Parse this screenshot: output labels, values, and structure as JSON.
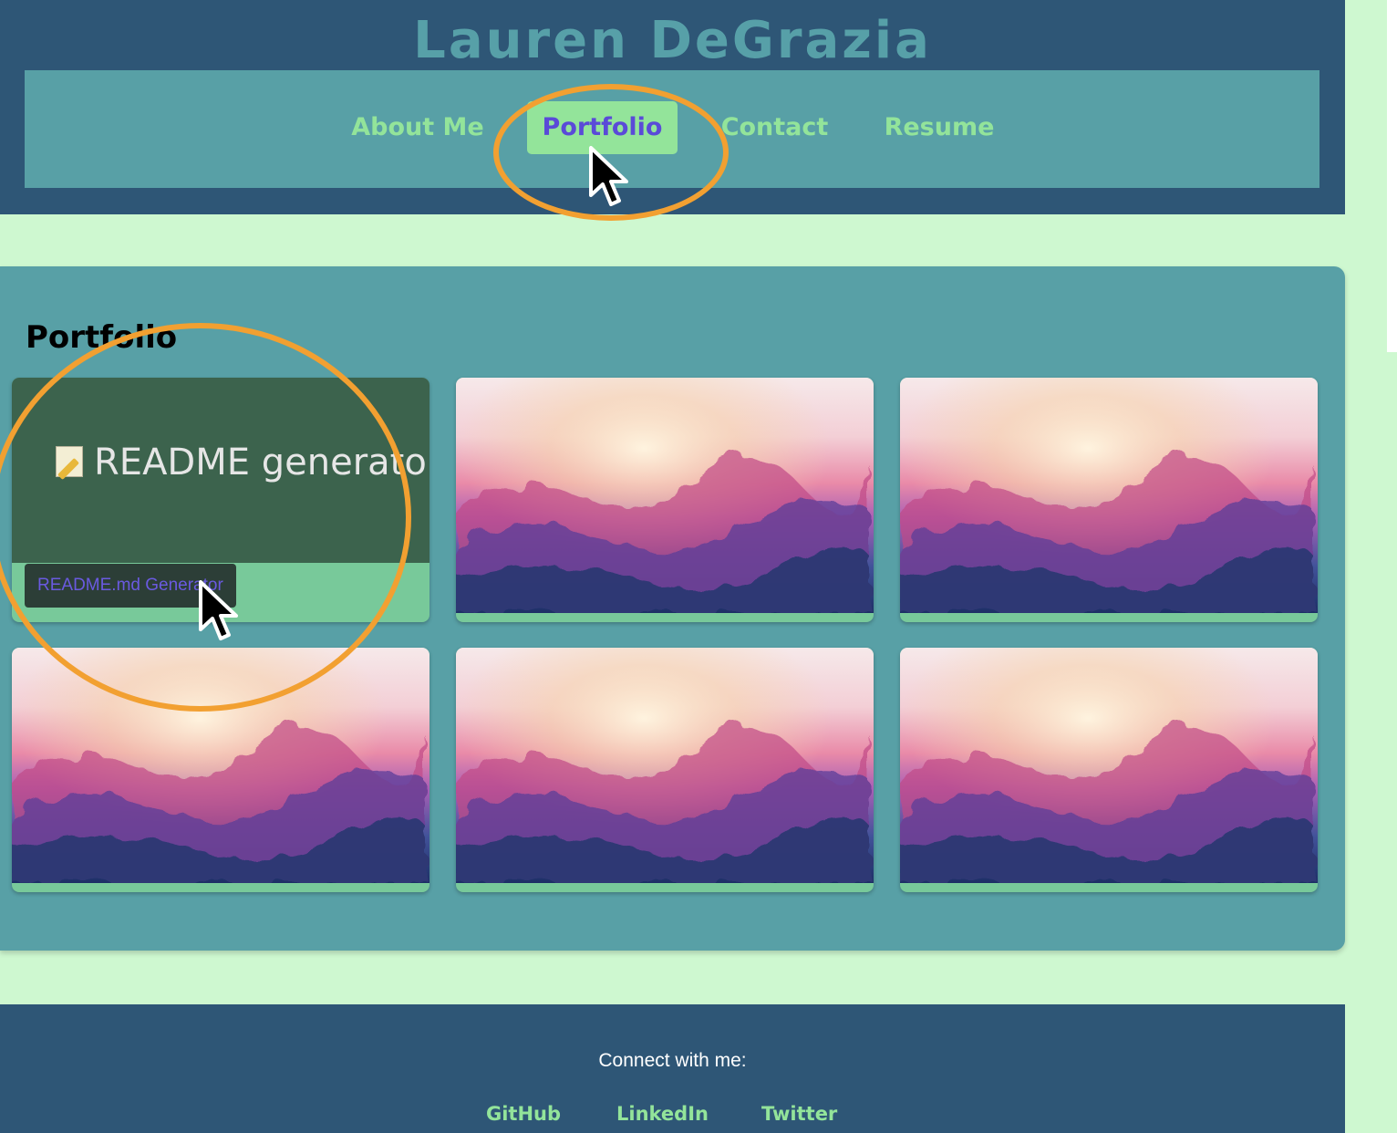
{
  "header": {
    "title": "Lauren DeGrazia"
  },
  "nav": {
    "items": [
      {
        "label": "About Me"
      },
      {
        "label": "Portfolio",
        "active": true
      },
      {
        "label": "Contact"
      },
      {
        "label": "Resume"
      }
    ]
  },
  "portfolio": {
    "title": "Portfolio",
    "cards": [
      {
        "thumb_text": "README generator",
        "thumb_icon": "memo-icon",
        "label": "README.md Generator"
      },
      {
        "thumb": "watercolor-image"
      },
      {
        "thumb": "watercolor-image"
      },
      {
        "thumb": "watercolor-image"
      },
      {
        "thumb": "watercolor-image"
      },
      {
        "thumb": "watercolor-image"
      }
    ]
  },
  "footer": {
    "connect_text": "Connect with me:",
    "links": [
      {
        "label": "GitHub"
      },
      {
        "label": "LinkedIn"
      },
      {
        "label": "Twitter"
      }
    ]
  },
  "colors": {
    "header_bg": "#2e5676",
    "nav_bg": "#58a0a6",
    "nav_text": "#93e49a",
    "active_text": "#5a4ad8",
    "page_bg": "#cef8d0",
    "highlight": "#f2a031",
    "card_readme_bg": "#3c634d",
    "card_strip": "#78c99a"
  }
}
